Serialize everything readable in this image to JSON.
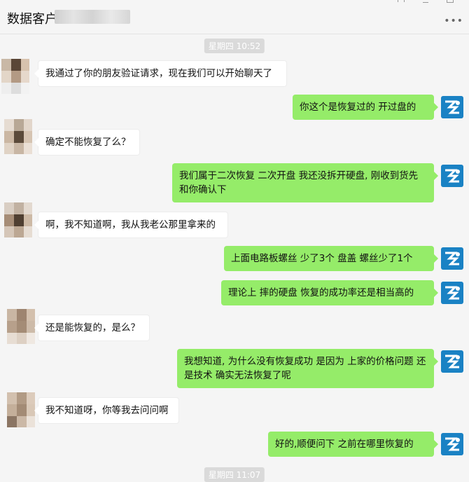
{
  "header": {
    "title": "数据客户",
    "more_icon": "more-icon"
  },
  "colors": {
    "out_bubble": "#95ec69",
    "in_bubble": "#ffffff",
    "logo_blue": "#1a82c4",
    "background": "#f5f5f5"
  },
  "timestamps": [
    "星期四 10:52",
    "星期四 11:07"
  ],
  "messages": [
    {
      "side": "in",
      "text": "我通过了你的朋友验证请求，现在我们可以开始聊天了"
    },
    {
      "side": "out",
      "text": "你这个是恢复过的 开过盘的"
    },
    {
      "side": "in",
      "text": "确定不能恢复了么？"
    },
    {
      "side": "out",
      "text": "我们属于二次恢复  二次开盘   我还没拆开硬盘, 刚收到货先和你确认下"
    },
    {
      "side": "in",
      "text": "啊，我不知道啊，我从我老公那里拿来的"
    },
    {
      "side": "out",
      "text": "上面电路板螺丝 少了3个  盘盖 螺丝少了1个"
    },
    {
      "side": "out",
      "text": "理论上 摔的硬盘  恢复的成功率还是相当高的"
    },
    {
      "side": "in",
      "text": "还是能恢复的，是么？"
    },
    {
      "side": "out",
      "text": "我想知道, 为什么没有恢复成功  是因为 上家的价格问题 还是技术 确实无法恢复了呢"
    },
    {
      "side": "in",
      "text": "我不知道呀，你等我去问问啊"
    },
    {
      "side": "out",
      "text": "好的,顺便问下 之前在哪里恢复的"
    }
  ]
}
